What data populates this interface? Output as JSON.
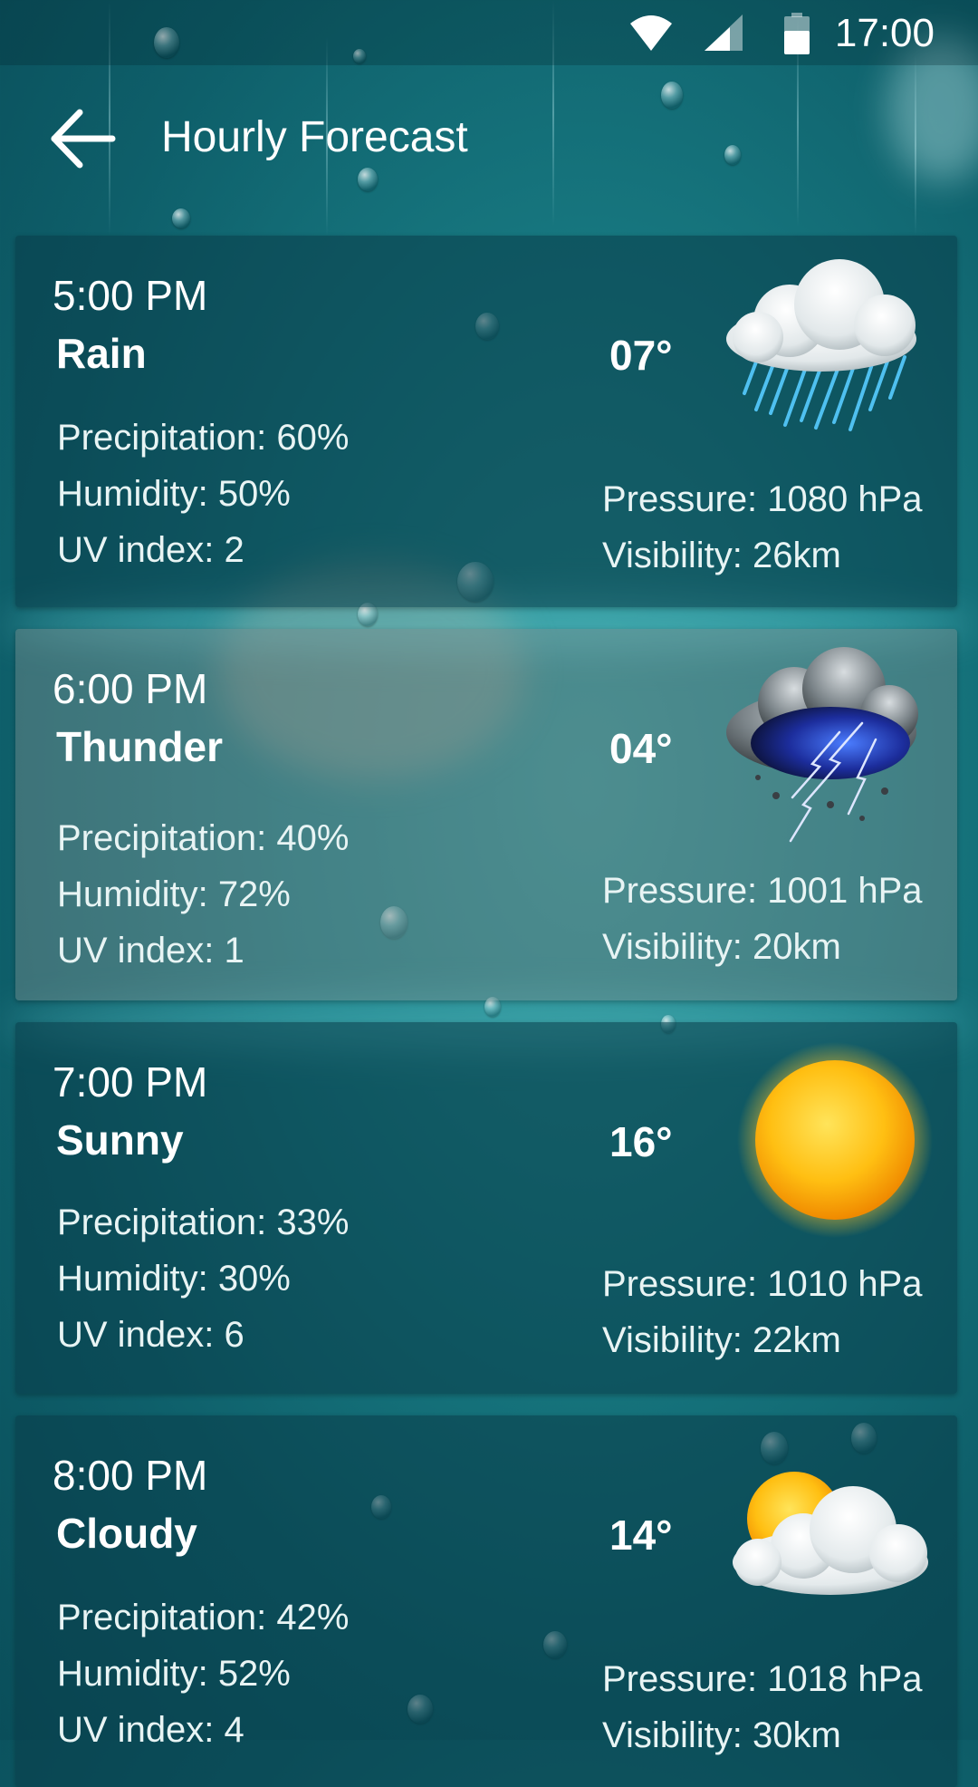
{
  "status_bar": {
    "time": "17:00",
    "icons": [
      "wifi-icon",
      "cell-signal-icon",
      "battery-icon"
    ]
  },
  "app_bar": {
    "back_icon": "arrow-left-icon",
    "title": "Hourly Forecast"
  },
  "forecast": [
    {
      "time": "5:00 PM",
      "condition": "Rain",
      "temperature": "07°",
      "precipitation": "Precipitation: 60%",
      "humidity": "Humidity: 50%",
      "uv_index": "UV index: 2",
      "pressure": "Pressure: 1080 hPa",
      "visibility": "Visibility: 26km",
      "icon": "rain-cloud-icon"
    },
    {
      "time": "6:00 PM",
      "condition": "Thunder",
      "temperature": "04°",
      "precipitation": "Precipitation: 40%",
      "humidity": "Humidity: 72%",
      "uv_index": "UV index: 1",
      "pressure": "Pressure: 1001 hPa",
      "visibility": "Visibility: 20km",
      "icon": "thunderstorm-icon"
    },
    {
      "time": "7:00 PM",
      "condition": "Sunny",
      "temperature": "16°",
      "precipitation": "Precipitation: 33%",
      "humidity": "Humidity: 30%",
      "uv_index": "UV index: 6",
      "pressure": "Pressure: 1010 hPa",
      "visibility": "Visibility: 22km",
      "icon": "sun-icon"
    },
    {
      "time": "8:00 PM",
      "condition": "Cloudy",
      "temperature": "14°",
      "precipitation": "Precipitation: 42%",
      "humidity": "Humidity: 52%",
      "uv_index": "UV index: 4",
      "pressure": "Pressure: 1018 hPa",
      "visibility": "Visibility: 30km",
      "icon": "partly-cloudy-icon"
    }
  ],
  "colors": {
    "background": "#187a82",
    "card_dark": "#0a3c48",
    "card_light": "#788c8c",
    "text": "#ffffff"
  }
}
